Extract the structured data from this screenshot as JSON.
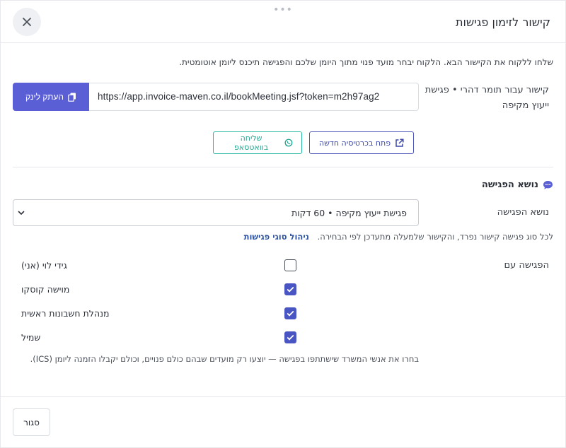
{
  "header": {
    "title": "קישור לזימון פגישות",
    "close_icon": "close-icon"
  },
  "intro": "שלחו ללקוח את הקישור הבא. הלקוח יבחר מועד פנוי מתוך היומן שלכם והפגישה תיכנס ליומן אוטומטית.",
  "link": {
    "label": "קישור עבור תומר דהרי • פגישת ייעוץ מקיפה",
    "url": "https://app.invoice-maven.co.il/bookMeeting.jsf?token=m2h97ag2",
    "copy_label": "העתק לינק",
    "open_new_tab_label": "פתח בכרטיסיה חדשה",
    "whatsapp_label": "שליחה בוואטסאפ"
  },
  "topic_section": {
    "title": "נושא הפגישה",
    "label": "נושא הפגישה",
    "selected": "פגישת ייעוץ מקיפה • 60 דקות",
    "hint": "לכל סוג פגישה קישור נפרד, והקישור שלמעלה מתעדכן לפי הבחירה.",
    "manage_link": "ניהול סוגי פגישות"
  },
  "attendees": {
    "label": "הפגישה עם",
    "items": [
      {
        "name": "גידי לוי (אני)",
        "checked": false
      },
      {
        "name": "מוישה קוסקו",
        "checked": true
      },
      {
        "name": "מנהלת חשבונות ראשית",
        "checked": true
      },
      {
        "name": "שמיל",
        "checked": true
      }
    ],
    "hint": "בחרו את אנשי המשרד שישתתפו בפגישה — יוצעו רק מועדים שבהם כולם פנויים, וכולם יקבלו הזמנה ליומן (ICS)."
  },
  "footer": {
    "close_label": "סגור"
  },
  "colors": {
    "primary": "#5b5fd6",
    "whatsapp": "#27b8a2",
    "checkbox": "#4a55c4"
  }
}
